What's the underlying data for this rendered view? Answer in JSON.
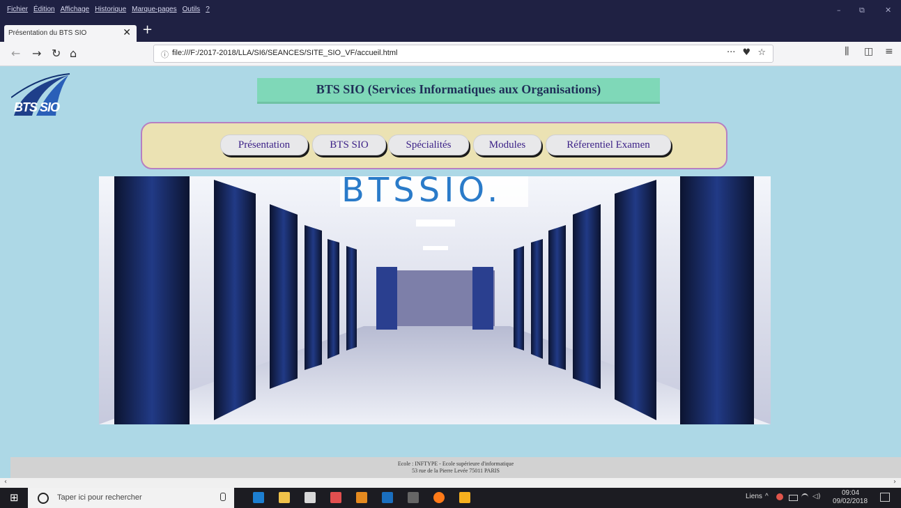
{
  "menubar": {
    "items": [
      "Fichier",
      "Édition",
      "Affichage",
      "Historique",
      "Marque-pages",
      "Outils",
      "?"
    ],
    "minimize": "–",
    "restore": "⧉",
    "close": "✕"
  },
  "tab": {
    "title": "Présentation du BTS SIO",
    "close": "✕",
    "new_tab": "+"
  },
  "navbar": {
    "back": "←",
    "forward": "→",
    "reload": "↻",
    "home": "⌂",
    "url_info": "ⓘ",
    "url": "file:///F:/2017-2018/LLA/SI6/SEANCES/SITE_SIO_VF/accueil.html",
    "page_actions": "···",
    "pocket": "♥",
    "bookmark": "☆",
    "library": "⫼",
    "sidebar": "◫",
    "menu": "≡"
  },
  "page": {
    "logo_text": "BTS SIO",
    "title": "BTS SIO (Services Informatiques aux Organisations)",
    "nav": [
      "Présentation",
      "BTS SIO",
      "Spécialités",
      "Modules",
      "Réferentiel Examen"
    ],
    "hero_banner": "BTSSIO.",
    "footer_line1": "Ecole : INFTYPE - Ecole supérieure d'informatique",
    "footer_line2": "53 rue de la Pierre Levée 75011 PARIS"
  },
  "taskbar": {
    "start": "⊞",
    "search_placeholder": "Taper ici pour rechercher",
    "mic": "🎙",
    "tray_links": "Liens",
    "tray_chevron": "^",
    "time": "09:04",
    "date": "09/02/2018",
    "notification": "🗨"
  },
  "colors": {
    "chrome_dark": "#1f2143",
    "page_bg": "#add8e6",
    "title_bg": "#7fd8b8",
    "nav_panel_bg": "#ebe2b3",
    "nav_panel_border": "#b67fc2",
    "button_text": "#3a1f86",
    "footer_bg": "#d2d2d2"
  }
}
